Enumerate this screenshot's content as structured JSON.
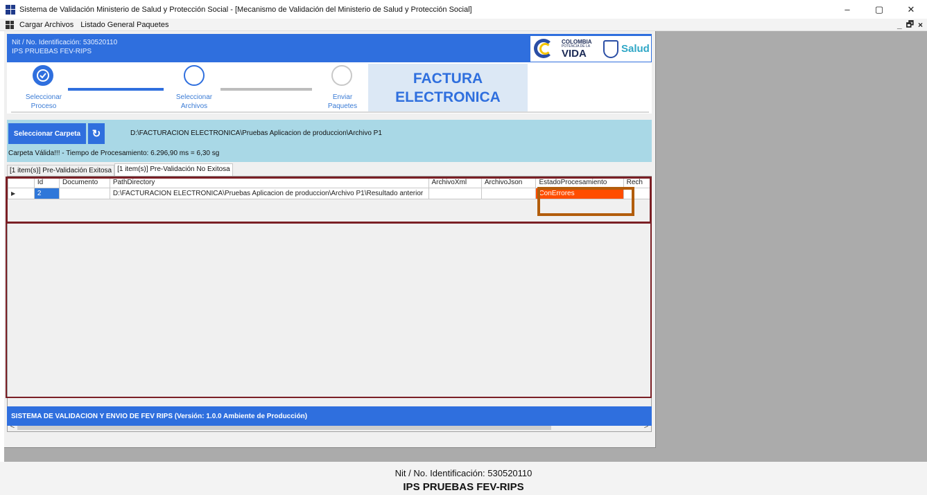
{
  "window": {
    "title": "Sistema de Validación Ministerio de Salud y Protección Social - [Mecanismo de Validación del Ministerio de Salud y Protección Social]",
    "minimize": "–",
    "maximize": "▢",
    "close": "✕"
  },
  "menu": {
    "items": [
      "Cargar Archivos",
      "Listado General Paquetes"
    ],
    "mdi_controls": [
      "_",
      "🗗",
      "×"
    ]
  },
  "header": {
    "nit": "Nit / No. Identificación: 530520110",
    "ips": "IPS PRUEBAS FEV-RIPS",
    "logo": {
      "line1": "COLOMBIA",
      "line2": "POTENCIA DE LA",
      "line3": "VIDA",
      "salud": "Salud"
    }
  },
  "stepper": {
    "steps": [
      {
        "label": "Seleccionar Proceso",
        "state": "done"
      },
      {
        "label": "Seleccionar Archivos",
        "state": "current"
      },
      {
        "label": "Enviar Paquetes",
        "state": "pending"
      }
    ],
    "badge_line1": "FACTURA",
    "badge_line2": "ELECTRONICA"
  },
  "folder": {
    "select_button": "Seleccionar Carpeta",
    "refresh_icon": "refresh-icon",
    "path": "D:\\FACTURACION ELECTRONICA\\Pruebas Aplicacion de produccion\\Archivo P1",
    "processing": "Carpeta Válida!!! - Tiempo de Procesamiento: 6.296,90 ms = 6,30 sg"
  },
  "tabs": [
    {
      "label": "[1 item(s)] Pre-Validación Exitosa",
      "active": false
    },
    {
      "label": "[1 item(s)] Pre-Validación No Exitosa",
      "active": true
    }
  ],
  "grid": {
    "columns": [
      "Id",
      "Documento",
      "PathDirectory",
      "ArchivoXml",
      "ArchivoJson",
      "EstadoProcesamiento",
      "Rech"
    ],
    "rows": [
      {
        "indicator": "▶",
        "id": "2",
        "documento": "",
        "path": "D:\\FACTURACION ELECTRONICA\\Pruebas Aplicacion de produccion\\Archivo P1\\Resultado anterior",
        "xml": "",
        "json": "",
        "estado": "ConErrores",
        "rech": ""
      }
    ],
    "scroll_left": "<",
    "scroll_right": ">"
  },
  "footer": {
    "text": "SISTEMA DE VALIDACION Y ENVIO DE FEV RIPS  (Versión: 1.0.0 Ambiente de Producción)"
  },
  "status": {
    "nit": "Nit / No. Identificación: 530520110",
    "ips": "IPS PRUEBAS FEV-RIPS"
  },
  "colors": {
    "primary_blue": "#2f6fde",
    "panel_cyan": "#a9d8e6",
    "error_orange": "#ff4d00",
    "highlight_maroon": "#7a1f25",
    "highlight_brown": "#b25d0c"
  }
}
